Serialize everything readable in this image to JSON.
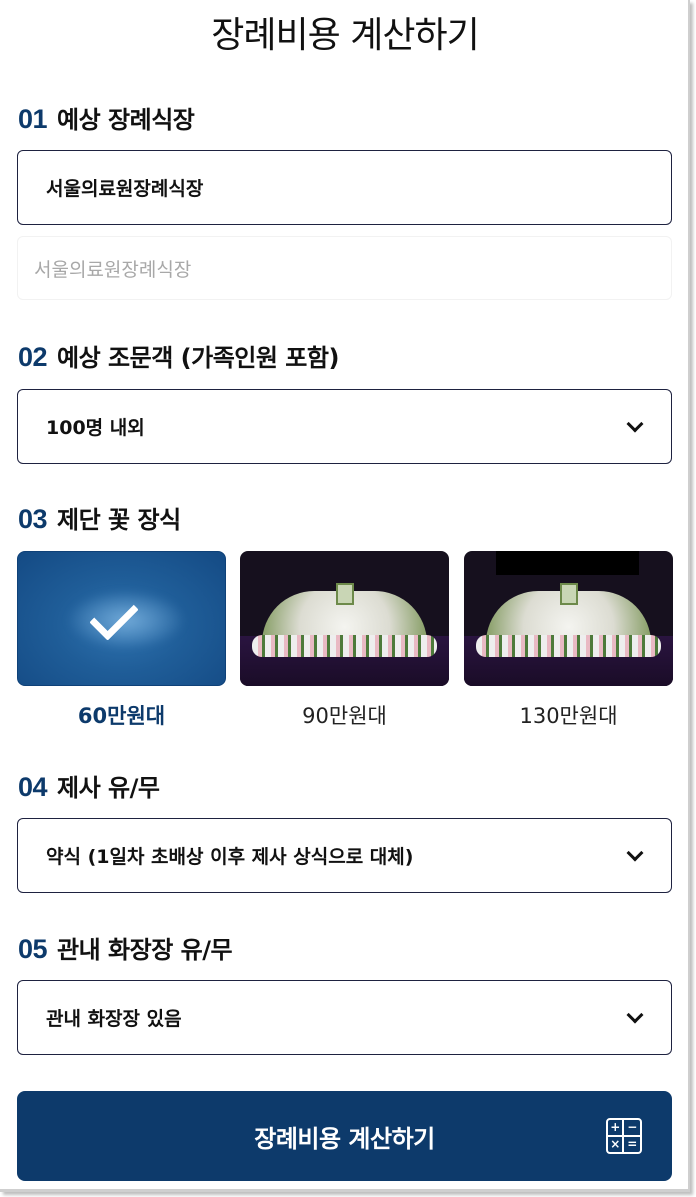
{
  "header": {
    "title": "장례비용 계산하기"
  },
  "sections": [
    {
      "num": "01",
      "title": "예상 장례식장"
    },
    {
      "num": "02",
      "title": "예상 조문객 (가족인원 포함)"
    },
    {
      "num": "03",
      "title": "제단 꽃 장식"
    },
    {
      "num": "04",
      "title": "제사 유/무"
    },
    {
      "num": "05",
      "title": "관내 화장장 유/무"
    }
  ],
  "funeral_hall": {
    "value": "서울의료원장례식장",
    "suggestion": "서울의료원장례식장"
  },
  "guests": {
    "selected": "100명 내외"
  },
  "flowers": {
    "options": [
      {
        "label": "60만원대",
        "selected": true
      },
      {
        "label": "90만원대",
        "selected": false
      },
      {
        "label": "130만원대",
        "selected": false
      }
    ]
  },
  "ritual": {
    "selected": "약식 (1일차 초배상 이후 제사 상식으로 대체)"
  },
  "crematorium": {
    "selected": "관내 화장장 있음"
  },
  "submit": {
    "label": "장례비용 계산하기",
    "icon": "calculator-icon"
  },
  "colors": {
    "accent": "#0d3a6b",
    "border": "#1e2240"
  }
}
